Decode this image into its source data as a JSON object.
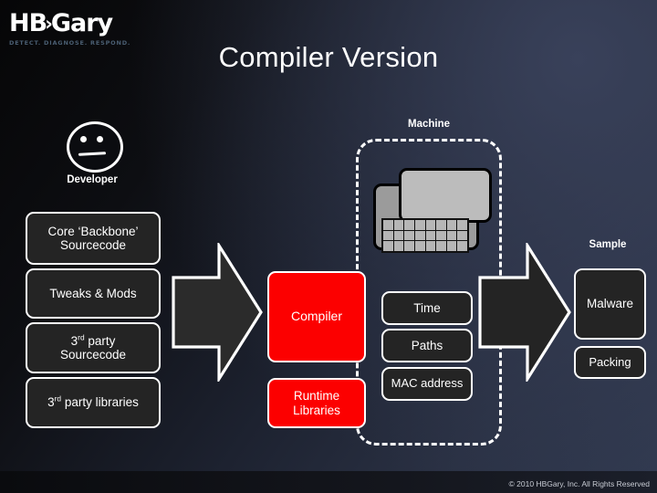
{
  "brand": {
    "wordmark_left": "HB",
    "wordmark_triangle": "›",
    "wordmark_right": "Gary",
    "tagline": "DETECT.  DIAGNOSE.  RESPOND."
  },
  "slide": {
    "title": "Compiler Version",
    "copyright": "© 2010 HBGary, Inc. All Rights Reserved"
  },
  "developer": {
    "label": "Developer",
    "icon": "face-neutral-icon"
  },
  "inputs": {
    "items": [
      {
        "label_line1": "Core ‘Backbone’",
        "label_line2": "Sourcecode"
      },
      {
        "label_line1": "Tweaks & Mods",
        "label_line2": ""
      },
      {
        "label_line1": "3rd party",
        "label_line2": "Sourcecode"
      },
      {
        "label_line1": "3rd party libraries",
        "label_line2": ""
      }
    ]
  },
  "machine": {
    "label": "Machine",
    "icon": "computer-keyboard-icon",
    "compiler_label": "Compiler",
    "runtime_line1": "Runtime",
    "runtime_line2": "Libraries",
    "artifacts": [
      {
        "label": "Time"
      },
      {
        "label": "Paths"
      },
      {
        "label": "MAC address"
      }
    ]
  },
  "sample": {
    "label": "Sample",
    "malware_label": "Malware",
    "packing_label": "Packing"
  },
  "arrows": {
    "left_name": "flow-arrow-right-1",
    "right_name": "flow-arrow-right-2"
  },
  "colors": {
    "accent_red": "#fc0000",
    "node_dark": "#222222",
    "outline": "#ffffff",
    "bg_dark": "#0a0a0c",
    "bg_navy": "#313a50",
    "tagline": "#4a5e72"
  }
}
